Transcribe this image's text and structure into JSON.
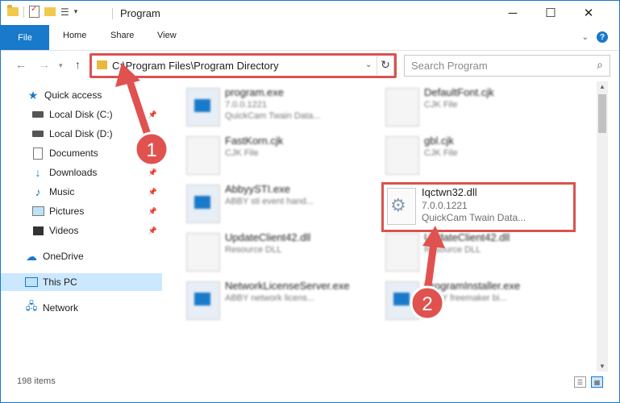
{
  "titlebar": {
    "title": "Program",
    "minimize": "─",
    "maximize": "☐",
    "close": "✕"
  },
  "ribbon": {
    "tabs": [
      "File",
      "Home",
      "Share",
      "View"
    ],
    "help": "?"
  },
  "nav": {
    "address": "C:\\Program Files\\Program Directory",
    "search_placeholder": "Search Program"
  },
  "sidebar": {
    "items": [
      {
        "label": "Quick access",
        "icon": "star-icon"
      },
      {
        "label": "Local Disk (C:)",
        "icon": "disk-icon"
      },
      {
        "label": "Local Disk (D:)",
        "icon": "disk-icon"
      },
      {
        "label": "Documents",
        "icon": "documents-icon"
      },
      {
        "label": "Downloads",
        "icon": "download-icon"
      },
      {
        "label": "Music",
        "icon": "music-icon"
      },
      {
        "label": "Pictures",
        "icon": "pictures-icon"
      },
      {
        "label": "Videos",
        "icon": "videos-icon"
      },
      {
        "label": "OneDrive",
        "icon": "cloud-icon"
      },
      {
        "label": "This PC",
        "icon": "pc-icon"
      },
      {
        "label": "Network",
        "icon": "network-icon"
      }
    ]
  },
  "files": [
    {
      "name": "program.exe",
      "line2": "7.0.0.1221",
      "line3": "QuickCam Twain Data..."
    },
    {
      "name": "DefaultFont.cjk",
      "line2": "CJK File",
      "line3": ""
    },
    {
      "name": "FastKorn.cjk",
      "line2": "CJK File",
      "line3": ""
    },
    {
      "name": "gbl.cjk",
      "line2": "CJK File",
      "line3": ""
    },
    {
      "name": "AbbyySTI.exe",
      "line2": "ABBY sti event hand...",
      "line3": ""
    },
    {
      "name": "UpdateClient42.dll",
      "line2": "Resource DLL",
      "line3": ""
    },
    {
      "name": "UpdateClient42.dll",
      "line2": "Resource DLL",
      "line3": ""
    },
    {
      "name": "NetworkLicenseServer.exe",
      "line2": "ABBY network licens...",
      "line3": ""
    },
    {
      "name": "ProgramInstaller.exe",
      "line2": "ABBY freemaker bi...",
      "line3": ""
    }
  ],
  "highlighted_file": {
    "name": "Iqctwn32.dll",
    "version": "7.0.0.1221",
    "description": "QuickCam Twain Data..."
  },
  "status": {
    "items_count": "198 items"
  },
  "callouts": {
    "step1": "1",
    "step2": "2"
  },
  "colors": {
    "accent": "#1979ca",
    "highlight": "#d9534f"
  }
}
